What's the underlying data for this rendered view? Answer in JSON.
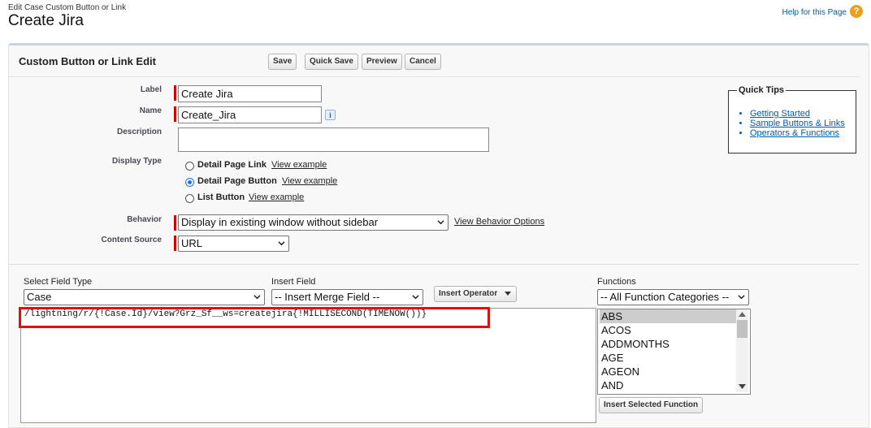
{
  "header": {
    "breadcrumb": "Edit Case Custom Button or Link",
    "title": "Create Jira",
    "help_link": "Help for this Page",
    "help_icon": "?"
  },
  "panel": {
    "title": "Custom Button or Link Edit",
    "buttons": {
      "save": "Save",
      "quick_save": "Quick Save",
      "preview": "Preview",
      "cancel": "Cancel"
    }
  },
  "form": {
    "label": {
      "label": "Label",
      "value": "Create Jira"
    },
    "name": {
      "label": "Name",
      "value": "Create_Jira",
      "info_icon": "i"
    },
    "description": {
      "label": "Description",
      "value": ""
    },
    "display_type": {
      "label": "Display Type",
      "options": [
        {
          "text": "Detail Page Link",
          "link": "View example",
          "selected": false
        },
        {
          "text": "Detail Page Button",
          "link": "View example",
          "selected": true
        },
        {
          "text": "List Button",
          "link": "View example",
          "selected": false
        }
      ]
    },
    "behavior": {
      "label": "Behavior",
      "value": "Display in existing window without sidebar",
      "link": "View Behavior Options"
    },
    "content_source": {
      "label": "Content Source",
      "value": "URL"
    }
  },
  "quick_tips": {
    "title": "Quick Tips",
    "links": [
      "Getting Started",
      "Sample Buttons & Links",
      "Operators & Functions"
    ]
  },
  "editor": {
    "select_field_type": {
      "label": "Select Field Type",
      "value": "Case"
    },
    "insert_field": {
      "label": "Insert Field",
      "value": "-- Insert Merge Field --"
    },
    "insert_operator": "Insert Operator",
    "formula": "/lightning/r/{!Case.Id}/view?Grz_Sf__ws=createjira{!MILLISECOND(TIMENOW())}",
    "functions": {
      "label": "Functions",
      "category": "-- All Function Categories --",
      "items": [
        "ABS",
        "ACOS",
        "ADDMONTHS",
        "AGE",
        "AGEON",
        "AND"
      ],
      "selected": "ABS",
      "insert_button": "Insert Selected Function"
    }
  },
  "colors": {
    "required": "#cc0000",
    "highlight": "#e01010",
    "link": "#015ba7",
    "help_icon": "#e9a021"
  }
}
